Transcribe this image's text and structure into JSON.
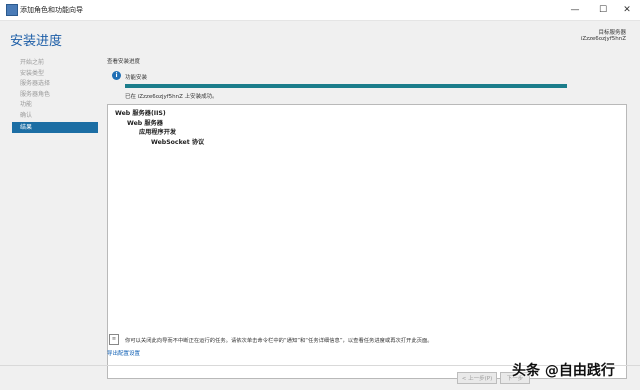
{
  "window": {
    "title": "添加角色和功能向导",
    "minimize": "—",
    "maximize": "☐",
    "close": "✕"
  },
  "header": {
    "page_title": "安装进度",
    "target_label": "目标服务器",
    "target_server": "iZzze6ozjyf5hnZ"
  },
  "sidebar": {
    "items": [
      {
        "label": "开始之前",
        "active": false
      },
      {
        "label": "安装类型",
        "active": false
      },
      {
        "label": "服务器选择",
        "active": false
      },
      {
        "label": "服务器角色",
        "active": false
      },
      {
        "label": "功能",
        "active": false
      },
      {
        "label": "确认",
        "active": false
      },
      {
        "label": "结果",
        "active": true
      }
    ]
  },
  "main": {
    "section_label": "查看安装进度",
    "status_icon": "info-icon",
    "status_text": "功能安装",
    "progress_percent": 100,
    "success_text": "已在 iZzze6ozjyf5hnZ 上安装成功。",
    "tree": [
      {
        "label": "Web 服务器(IIS)",
        "level": 0
      },
      {
        "label": "Web 服务器",
        "level": 1
      },
      {
        "label": "应用程序开发",
        "level": 2
      },
      {
        "label": "WebSocket 协议",
        "level": 3
      }
    ],
    "note_text": "你可以关闭此向导而不中断正在运行的任务。请依次单击命令栏中的“通知”和“任务详细信息”，以查看任务进度或再次打开此页面。",
    "export_link": "导出配置设置"
  },
  "footer": {
    "prev_label": "< 上一步(P)",
    "next_label": "下一步"
  },
  "watermark": "头条 @自由践行",
  "colors": {
    "accent": "#1e5fa8",
    "nav_active": "#1c6ea4",
    "progress": "#1b7d8b"
  }
}
